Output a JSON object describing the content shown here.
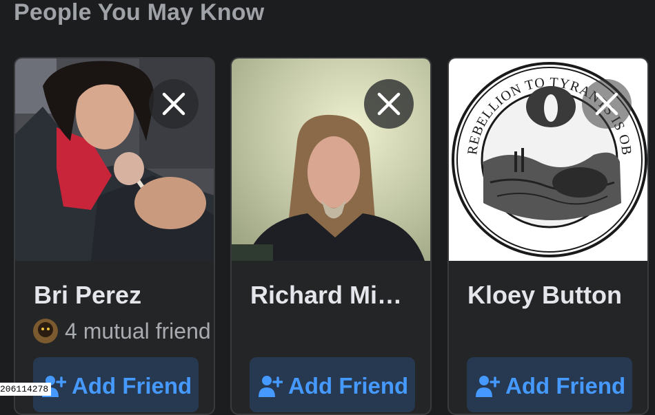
{
  "section": {
    "title": "People You May Know"
  },
  "cards": [
    {
      "name": "Bri Perez",
      "mutual_friends": "4 mutual friend",
      "add_label": "Add Friend",
      "photo_desc": "bri-perez-photo"
    },
    {
      "name": "Richard Mi…",
      "mutual_friends": "",
      "add_label": "Add Friend",
      "photo_desc": "richard-photo"
    },
    {
      "name": "Kloey Button",
      "mutual_friends": "",
      "add_label": "Add Friend",
      "photo_desc": "kloey-button-photo",
      "photo_text": "REBELLION TO TYRANTS IS OBEDIENCE TO GOD."
    }
  ],
  "footer": {
    "id_text": "206114278"
  },
  "icons": {
    "close": "close-icon",
    "add_friend": "add-friend-icon"
  },
  "colors": {
    "background": "#1c1d1f",
    "card": "#242526",
    "accent": "#4599ff",
    "button_bg": "#263951",
    "title": "#9fa2a7",
    "name": "#e4e6eb"
  }
}
